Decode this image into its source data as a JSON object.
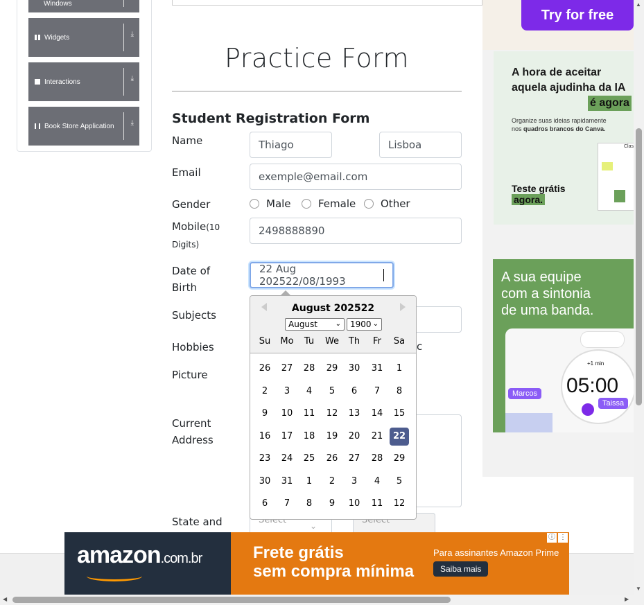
{
  "sidebar": {
    "items": [
      {
        "label": "Windows",
        "icon": "windows-icon"
      },
      {
        "label": "Widgets",
        "icon": "grid-icon"
      },
      {
        "label": "Interactions",
        "icon": "interactions-icon"
      },
      {
        "label": "Book Store Application",
        "icon": "book-icon"
      }
    ]
  },
  "form": {
    "title": "Practice Form",
    "subtitle": "Student Registration Form",
    "name_label": "Name",
    "first_name": "Thiago",
    "last_name": "Lisboa",
    "email_label": "Email",
    "email_value": "exemple@email.com",
    "gender_label": "Gender",
    "gender_options": [
      "Male",
      "Female",
      "Other"
    ],
    "mobile_label": "Mobile",
    "mobile_hint": "(10",
    "mobile_hint2": "Digits)",
    "mobile_value": "2498888890",
    "dob_label_1": "Date of",
    "dob_label_2": "Birth",
    "dob_value": "22 Aug 202522/08/1993",
    "subjects_label": "Subjects",
    "hobbies_label": "Hobbies",
    "hobbies_peek": "c",
    "picture_label": "Picture",
    "address_label_1": "Current",
    "address_label_2": "Address",
    "state_label": "State and",
    "state_placeholder": "Select",
    "city_placeholder": "Select"
  },
  "datepicker": {
    "month_title": "August 202522",
    "month_select": "August",
    "year_select": "1900",
    "day_names": [
      "Su",
      "Mo",
      "Tu",
      "We",
      "Th",
      "Fr",
      "Sa"
    ],
    "weeks": [
      [
        "26",
        "27",
        "28",
        "29",
        "30",
        "31",
        "1"
      ],
      [
        "2",
        "3",
        "4",
        "5",
        "6",
        "7",
        "8"
      ],
      [
        "9",
        "10",
        "11",
        "12",
        "13",
        "14",
        "15"
      ],
      [
        "16",
        "17",
        "18",
        "19",
        "20",
        "21",
        "22"
      ],
      [
        "23",
        "24",
        "25",
        "26",
        "27",
        "28",
        "29"
      ],
      [
        "30",
        "31",
        "1",
        "2",
        "3",
        "4",
        "5"
      ],
      [
        "6",
        "7",
        "8",
        "9",
        "10",
        "11",
        "12"
      ]
    ],
    "selected_day": "22"
  },
  "ads": {
    "try_free": "Try for free",
    "canva_headline_1": "A hora de aceitar",
    "canva_headline_2": "aquela ajudinha da IA",
    "canva_headline_3": "é agora",
    "canva_sub_1": "Organize suas ideias rapidamente",
    "canva_sub_2": "nos",
    "canva_sub_bold": "quadros brancos do Canva.",
    "canva_cta_1": "Teste grátis",
    "canva_cta_2": "agora.",
    "canva_tag": "Class",
    "team_1": "A sua equipe",
    "team_2": "com a sintonia",
    "team_3": "de uma banda.",
    "user_1": "Marcos",
    "user_2": "Taissa",
    "timer": "05:00",
    "timer_badge": "+1 min",
    "amazon_logo": "amazon",
    "amazon_domain": ".com.br",
    "amazon_headline_1": "Frete grátis",
    "amazon_headline_2": "sem compra mínima",
    "amazon_sub": "Para assinantes Amazon Prime",
    "amazon_cta": "Saiba mais"
  },
  "colors": {
    "sidebar_item": "#6c6e75",
    "selected_day": "#4d5c8e",
    "canva_green": "#6ba05a",
    "amazon_orange": "#e47911",
    "amazon_dark": "#232f3e",
    "try_free_purple": "#7d2ae8"
  }
}
